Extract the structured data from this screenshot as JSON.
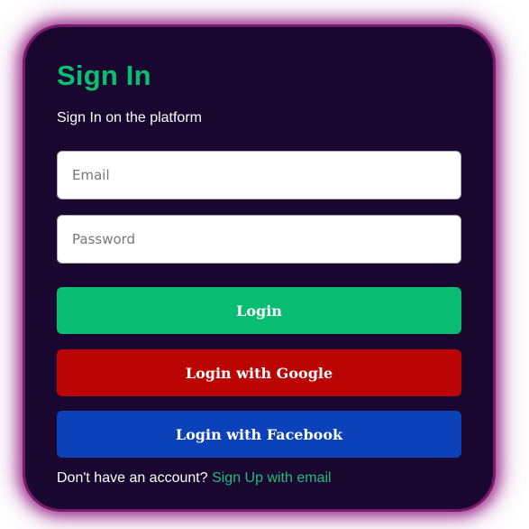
{
  "colors": {
    "card_background": "#1a0730",
    "glow": "#7a1a6e",
    "accent_green": "#08c072",
    "login_button": "#08bd72",
    "google_button": "#bb0505",
    "facebook_button": "#0b42b9"
  },
  "header": {
    "title": "Sign In",
    "subtitle": "Sign In on the platform"
  },
  "form": {
    "email": {
      "value": "",
      "placeholder": "Email"
    },
    "password": {
      "value": "",
      "placeholder": "Password"
    }
  },
  "buttons": {
    "login_label": "Login",
    "google_label": "Login with Google",
    "facebook_label": "Login with Facebook"
  },
  "footer": {
    "prompt": "Don't have an account?",
    "signup_link": "Sign Up with email"
  }
}
